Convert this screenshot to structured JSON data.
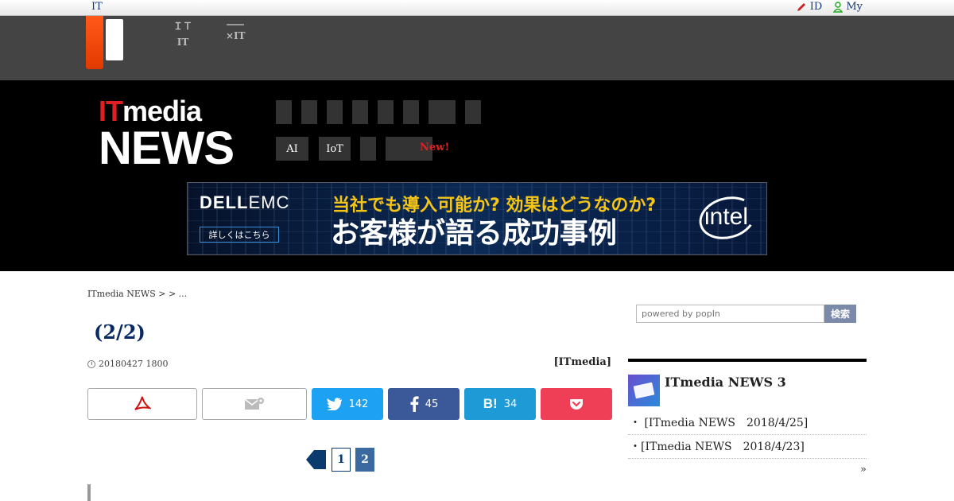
{
  "topbar": {
    "brand": "IT",
    "links": [
      {
        "label": "ID",
        "icon": "pencil-icon"
      },
      {
        "label": "My",
        "icon": "user-icon"
      }
    ]
  },
  "network": {
    "items": [
      {
        "line1": "ＩＴ",
        "line2": "IT"
      },
      {
        "line1": "",
        "line2": "×IT"
      }
    ]
  },
  "header": {
    "logo_it": "IT",
    "logo_media": "media",
    "logo_news": "NEWS",
    "cat_row1": [
      "",
      "",
      "",
      "",
      "",
      "",
      "",
      ""
    ],
    "cat_row2": [
      "AI",
      "IoT",
      "",
      ""
    ],
    "new_tag": "New!"
  },
  "ad": {
    "brand_a": "DELL",
    "brand_b": "EMC",
    "cta": "詳しくはこちら",
    "line1": "当社でも導入可能か? 効果はどうなのか?",
    "line2": "お客様が語る成功事例",
    "partner": "intel"
  },
  "article": {
    "breadcrumb": "ITmedia NEWS >  > ...",
    "title": "(2/2)",
    "date": "20180427 1800",
    "author": "[ITmedia]"
  },
  "share": {
    "twitter": "142",
    "facebook": "45",
    "hatena_label": "B!",
    "hatena": "34"
  },
  "pager": {
    "pages": [
      "1",
      "2"
    ],
    "current": "2"
  },
  "sidebar": {
    "search_placeholder": "powered by popIn",
    "search_button": "検索",
    "box_title": "ITmedia NEWS 3",
    "items": [
      "・ [ITmedia NEWS　2018/4/25]",
      "・[ITmedia NEWS　2018/4/23]"
    ],
    "more": "»"
  }
}
